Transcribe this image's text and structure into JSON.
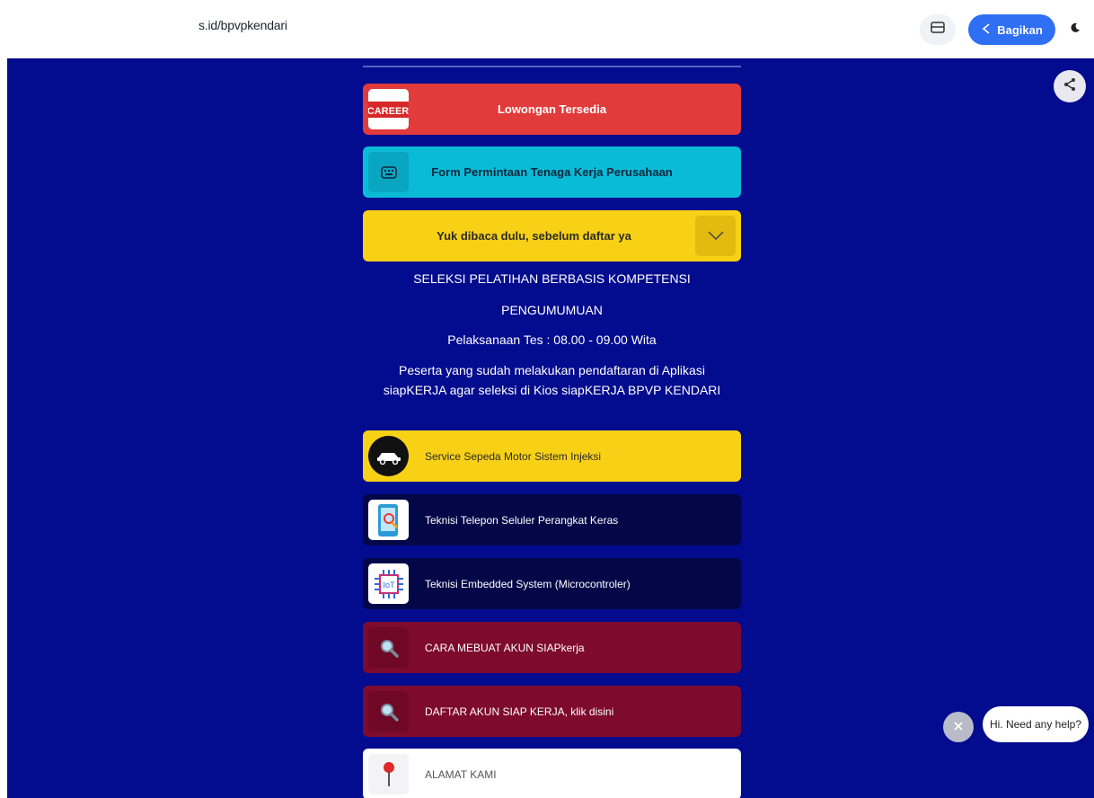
{
  "topbar": {
    "url": "s.id/bpvpkendari",
    "share_label": "Bagikan",
    "icons": [
      "card-icon",
      "share-icon",
      "moon-icon"
    ]
  },
  "links": {
    "lowongan": "Lowongan Tersedia",
    "form_permintaan": "Form Permintaan Tenaga Kerja Perusahaan",
    "yuk_dibaca": "Yuk dibaca dulu, sebelum daftar ya",
    "service_motor": "Service Sepeda Motor Sistem Injeksi",
    "teknisi_telepon": "Teknisi Telepon Seluler Perangkat Keras",
    "teknisi_embedded": "Teknisi Embedded System (Microcontroler)",
    "cara_membuat": "CARA MEBUAT AKUN SIAPkerja",
    "daftar_akun": "DAFTAR AKUN SIAP KERJA, klik disini",
    "alamat": "ALAMAT KAMI"
  },
  "thumbs": {
    "career": "CAREER",
    "iot": "IoT"
  },
  "announcement": {
    "line1": "SELEKSI PELATIHAN BERBASIS KOMPETENSI",
    "line2": "PENGUMUMUAN",
    "line3": "Pelaksanaan Tes : 08.00 - 09.00 Wita",
    "line4": "Peserta yang sudah melakukan pendaftaran di Aplikasi siapKERJA agar seleksi di Kios siapKERJA BPVP KENDARI"
  },
  "chat": {
    "bubble": "Hi. Need any help?"
  },
  "colors": {
    "background": "#030b8e",
    "red": "#e23b3b",
    "cyan": "#0abbd8",
    "yellow": "#f8d117",
    "navy": "#030748",
    "maroon": "#7e0a2e",
    "share_blue": "#2f6ff3"
  }
}
